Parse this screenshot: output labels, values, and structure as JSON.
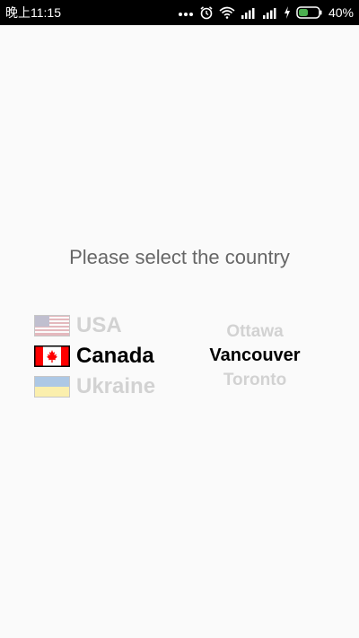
{
  "status_bar": {
    "time": "晚上11:15",
    "battery": "40%",
    "icons": [
      "more-icon",
      "alarm-icon",
      "wifi-icon",
      "signal-icon",
      "signal-icon",
      "charging-icon",
      "battery-icon"
    ]
  },
  "prompt": "Please select the country",
  "countries": [
    {
      "label": "USA",
      "flag": "usa-flag-icon",
      "selected": false
    },
    {
      "label": "Canada",
      "flag": "canada-flag-icon",
      "selected": true
    },
    {
      "label": "Ukraine",
      "flag": "ukraine-flag-icon",
      "selected": false
    }
  ],
  "cities": [
    {
      "label": "Ottawa",
      "selected": false
    },
    {
      "label": "Vancouver",
      "selected": true
    },
    {
      "label": "Toronto",
      "selected": false
    }
  ],
  "colors": {
    "selected_text": "#000000",
    "faded_text": "#d2d2d2",
    "prompt_text": "#666666",
    "background": "#fafafa",
    "status_bar": "#000000",
    "battery_fill": "#4caf50"
  }
}
